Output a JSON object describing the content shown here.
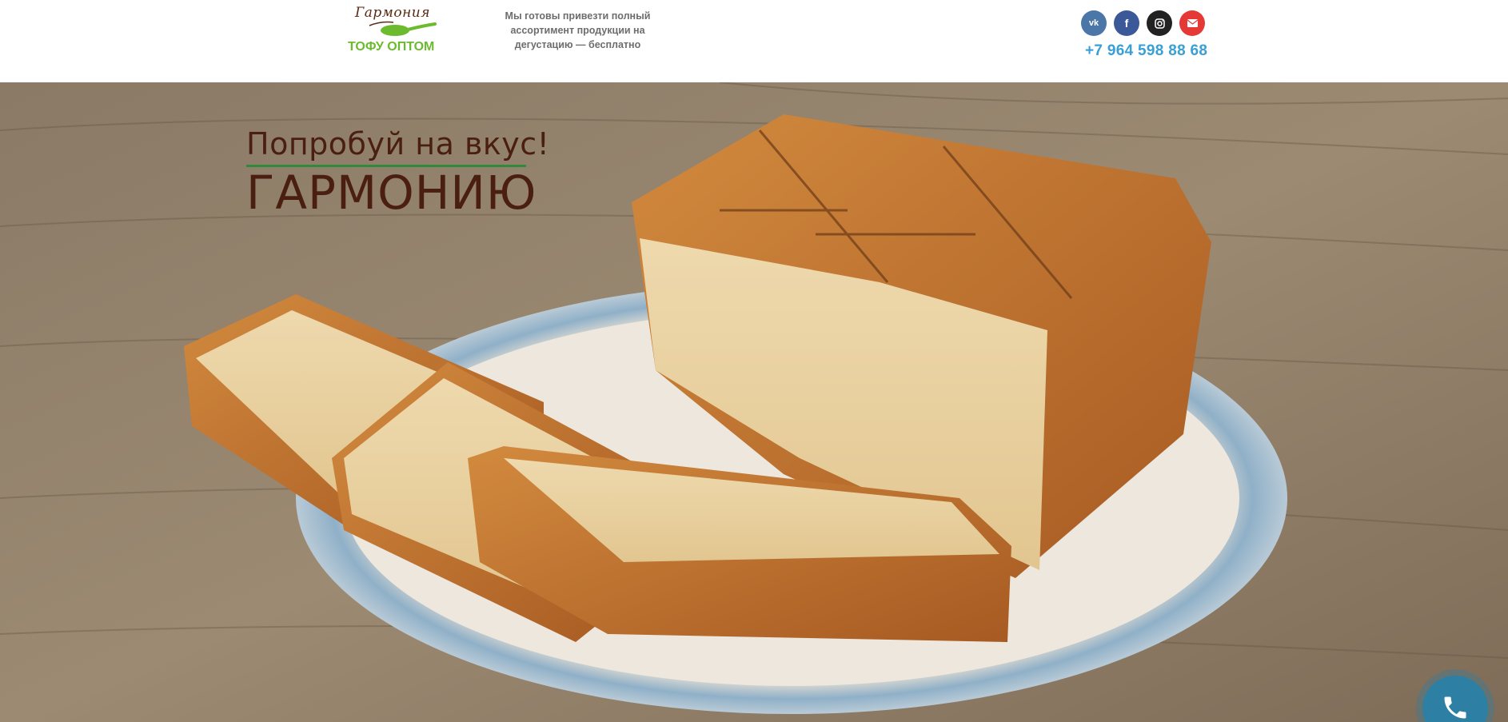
{
  "header": {
    "logo": {
      "script_text": "Гармония",
      "subtitle": "ТОФУ ОПТОМ",
      "icon": "spoon-logo-icon"
    },
    "tagline": "Мы готовы привезти полный ассортимент продукции на дегустацию — бесплатно",
    "socials": [
      {
        "name": "vk",
        "icon": "vk-icon",
        "color": "#4a76a8",
        "glyph": "vk"
      },
      {
        "name": "facebook",
        "icon": "facebook-icon",
        "color": "#3b5998",
        "glyph": "f"
      },
      {
        "name": "instagram",
        "icon": "instagram-icon",
        "color": "#222222",
        "glyph": ""
      },
      {
        "name": "email",
        "icon": "email-icon",
        "color": "#e53935",
        "glyph": ""
      }
    ],
    "phone": "+7 964 598 88 68"
  },
  "hero": {
    "line1": "Попробуй  на вкус!",
    "line2": "ГАРМОНИЮ",
    "image": "smoked-tofu-plate",
    "colors": {
      "title": "#4a1f12",
      "rule": "#2f8a3c"
    }
  },
  "call_button": {
    "icon": "phone-icon",
    "color": "#2d7fa4"
  },
  "colors": {
    "accent_green": "#6cbb2f",
    "phone_blue": "#3a9fd5"
  }
}
